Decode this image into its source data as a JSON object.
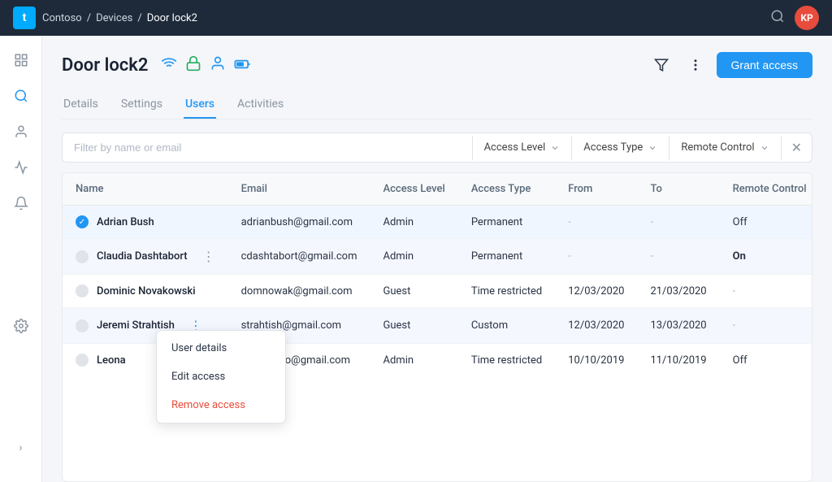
{
  "topbar": {
    "logo": "t",
    "breadcrumb": [
      "Contoso",
      "Devices",
      "Door lock2"
    ],
    "avatar": "KP"
  },
  "page": {
    "title": "Door lock2",
    "tabs": [
      "Details",
      "Settings",
      "Users",
      "Activities"
    ],
    "active_tab": "Users"
  },
  "filter": {
    "placeholder": "Filter by name or email",
    "dropdowns": [
      "Access Level",
      "Access Type",
      "Remote Control"
    ]
  },
  "table": {
    "headers": [
      "Name",
      "Email",
      "Access Level",
      "Access Type",
      "From",
      "To",
      "Remote Control"
    ],
    "rows": [
      {
        "name": "Adrian Bush",
        "email": "adrianbush@gmail.com",
        "access_level": "Admin",
        "access_type": "Permanent",
        "from": "-",
        "to": "-",
        "remote": "Off",
        "active": true,
        "hovered": false
      },
      {
        "name": "Claudia Dashtabort",
        "email": "cdashtabort@gmail.com",
        "access_level": "Admin",
        "access_type": "Permanent",
        "from": "-",
        "to": "-",
        "remote": "On",
        "active": false,
        "hovered": true
      },
      {
        "name": "Dominic Novakowski",
        "email": "domnowak@gmail.com",
        "access_level": "Guest",
        "access_type": "Time restricted",
        "from": "12/03/2020",
        "to": "21/03/2020",
        "remote": "-",
        "active": false,
        "hovered": false
      },
      {
        "name": "Jeremi Strahtish",
        "email": "strahtish@gmail.com",
        "access_level": "Guest",
        "access_type": "Custom",
        "from": "12/03/2020",
        "to": "13/03/2020",
        "remote": "-",
        "active": false,
        "hovered": false,
        "menu_open": true
      },
      {
        "name": "Leona",
        "email": "leonardo.o@gmail.com",
        "access_level": "Admin",
        "access_type": "Time restricted",
        "from": "10/10/2019",
        "to": "11/10/2019",
        "remote": "Off",
        "active": false,
        "hovered": false
      }
    ]
  },
  "context_menu": {
    "items": [
      "User details",
      "Edit access",
      "Remove access"
    ]
  },
  "buttons": {
    "grant_access": "Grant access"
  },
  "sidebar": {
    "icons": [
      "grid",
      "search",
      "person",
      "clock",
      "bell",
      "gear"
    ],
    "expand": "›"
  }
}
